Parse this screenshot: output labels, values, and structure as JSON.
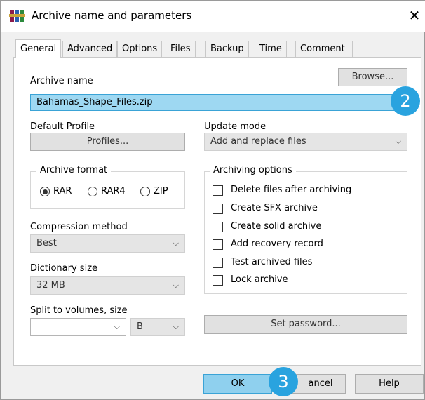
{
  "window": {
    "title": "Archive name and parameters",
    "close_glyph": "✕"
  },
  "tabs": [
    {
      "label": "General"
    },
    {
      "label": "Advanced"
    },
    {
      "label": "Options"
    },
    {
      "label": "Files"
    },
    {
      "label": "Backup"
    },
    {
      "label": "Time"
    },
    {
      "label": "Comment"
    }
  ],
  "archive_name": {
    "label": "Archive name",
    "browse_label": "Browse...",
    "value": "Bahamas_Shape_Files.zip"
  },
  "default_profile": {
    "label": "Default Profile",
    "button_label": "Profiles..."
  },
  "update_mode": {
    "label": "Update mode",
    "value": "Add and replace files"
  },
  "archive_format": {
    "title": "Archive format",
    "options": [
      {
        "label": "RAR",
        "selected": true
      },
      {
        "label": "RAR4",
        "selected": false
      },
      {
        "label": "ZIP",
        "selected": false
      }
    ]
  },
  "compression": {
    "label": "Compression method",
    "value": "Best"
  },
  "dictionary": {
    "label": "Dictionary size",
    "value": "32 MB"
  },
  "split": {
    "label": "Split to volumes, size",
    "value": "",
    "unit": "B"
  },
  "archiving_options": {
    "title": "Archiving options",
    "items": [
      {
        "label": "Delete files after archiving",
        "checked": false
      },
      {
        "label": "Create SFX archive",
        "checked": false
      },
      {
        "label": "Create solid archive",
        "checked": false
      },
      {
        "label": "Add recovery record",
        "checked": false
      },
      {
        "label": "Test archived files",
        "checked": false
      },
      {
        "label": "Lock archive",
        "checked": false
      }
    ]
  },
  "set_password_label": "Set password...",
  "footer": {
    "ok_label": "OK",
    "cancel_label": "ancel",
    "help_label": "Help"
  },
  "badges": {
    "step_2": "2",
    "step_3": "3"
  },
  "colors": {
    "accent": "#29a3df",
    "field_highlight": "#9ed8f2"
  },
  "icons": {
    "app": "winrar-books-icon",
    "chevron": "chevron-down-icon"
  }
}
